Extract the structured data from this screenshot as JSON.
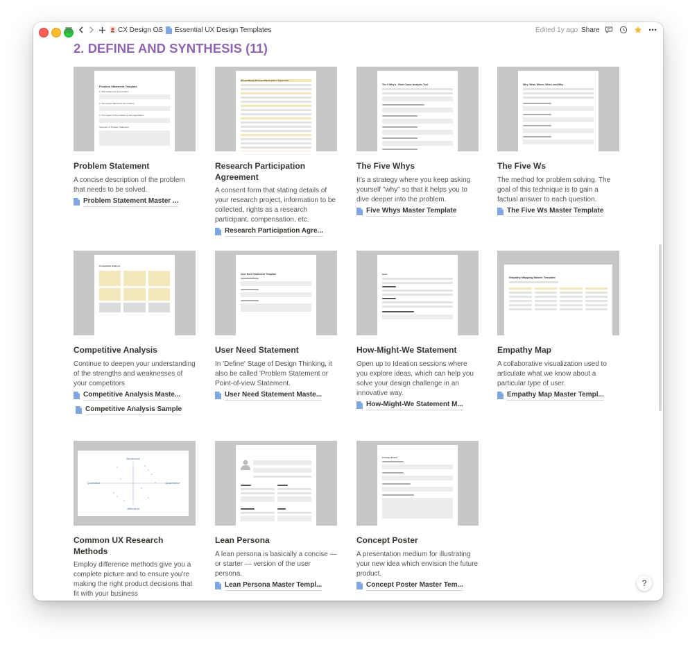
{
  "topbar": {
    "workspace": "CX Design OS",
    "separator": "/",
    "page": "Essential UX Design Templates",
    "edited": "Edited 1y ago",
    "share": "Share",
    "icons": [
      "sidebar-toggle-icon",
      "back-icon",
      "forward-icon",
      "add-icon",
      "comment-icon",
      "clock-icon",
      "star-icon",
      "more-icon"
    ]
  },
  "section": {
    "heading": "2. DEFINE AND SYNTHESIS (11)"
  },
  "cards": [
    {
      "title": "Problem Statement",
      "desc": "A concise description of the problem that needs to be solved.",
      "links": [
        "Problem Statement Master ..."
      ]
    },
    {
      "title": "Research Participation Agreement",
      "desc": "A consent form that stating details of your research project, information to be collected, rights as a research participant, compensation, etc.",
      "links": [
        "Research Participation Agre..."
      ]
    },
    {
      "title": "The Five Whys",
      "desc": "It's a strategy where you keep asking yourself \"why\" so that it helps you to dive deeper into the problem.",
      "links": [
        "Five Whys Master Template"
      ]
    },
    {
      "title": "The Five Ws",
      "desc": "The method for problem solving. The goal of this technique is to gain a factual answer to each question.",
      "links": [
        "The Five Ws Master Template"
      ]
    },
    {
      "title": "Competitive Analysis",
      "desc": "Continue to deepen your understanding of the strengths and weaknesses of your competitors",
      "links": [
        "Competitive Analysis Maste...",
        "Competitive Analysis Sample"
      ]
    },
    {
      "title": "User Need Statement",
      "desc": "In 'Define' Stage of Design Thinking, it also be called 'Problem Statement or Point-of-view Statement.",
      "links": [
        "User Need Statement Maste..."
      ]
    },
    {
      "title": "How-Might-We Statement",
      "desc": "Open up to Ideation sessions where you explore ideas, which can help you solve your design challenge in an innovative way.",
      "links": [
        "How-Might-We Statement M..."
      ]
    },
    {
      "title": "Empathy Map",
      "desc": "A collaborative visualization used to articulate what we know about a particular type of user.",
      "links": [
        "Empathy Map Master Templ..."
      ]
    },
    {
      "title": "Common UX Research Methods",
      "desc": "Employ difference methods give you a complete picture and to ensure you're making the right product decisions that fit with your business",
      "links": []
    },
    {
      "title": "Lean Persona",
      "desc": "A lean persona is basically a concise — or starter — version of the user persona.",
      "links": [
        "Lean Persona Master Templ..."
      ]
    },
    {
      "title": "Concept Poster",
      "desc": "A presentation medium for illustrating your new idea which envision the future product.",
      "links": [
        "Concept Poster Master Tem..."
      ]
    }
  ],
  "thumbs": {
    "problem": {
      "title": "Problem Statement Template",
      "items": [
        "1. The background of a problem",
        "2. The people affected by the problem",
        "3. The impact of the problem on the organization",
        "Summary of Problem Statement"
      ]
    },
    "research": {
      "title": "[ProjectName] ResearchParticipation Agreement"
    },
    "fivewhys": {
      "title": "The 5 Why's - Root Cause Analysis Tool"
    },
    "fivews": {
      "title": "Why, What, Where, When, and Why"
    },
    "competitive": {
      "title": "Competitive Analysis"
    },
    "userneed": {
      "title": "User Need Statement Template"
    },
    "hmw": {
      "title": "Goal"
    },
    "empathy": {
      "title": "Empathy Mapping Master Template"
    },
    "methods": {
      "top": "Behavioral",
      "bottom": "Attitudinal",
      "left": "Qualitative",
      "right": "Quantitative"
    },
    "concept": {
      "title": "Concept Poster"
    }
  },
  "help": "?"
}
